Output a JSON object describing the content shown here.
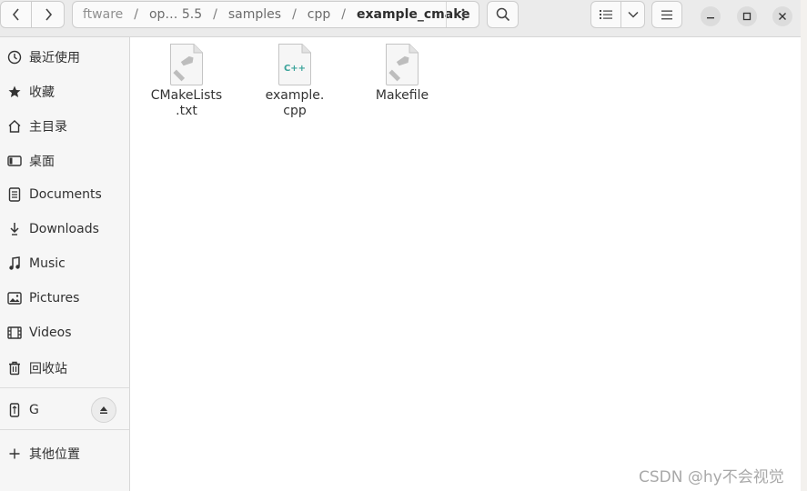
{
  "header": {
    "back_icon": "chevron-left-icon",
    "forward_icon": "chevron-right-icon",
    "path": {
      "segments": [
        "ftware",
        "op… 5.5",
        "samples",
        "cpp"
      ],
      "separator": "/",
      "current": "example_cmake"
    },
    "path_menu_icon": "vertical-ellipsis-icon",
    "search_icon": "search-icon",
    "view_icon": "list-view-icon",
    "view_dropdown_icon": "chevron-down-icon",
    "menu_icon": "hamburger-menu-icon",
    "minimize_icon": "minimize-icon",
    "maximize_icon": "maximize-icon",
    "close_icon": "close-icon"
  },
  "sidebar": {
    "items": [
      {
        "label": "最近使用",
        "icon": "clock-icon"
      },
      {
        "label": "收藏",
        "icon": "star-icon"
      },
      {
        "label": "主目录",
        "icon": "home-icon"
      },
      {
        "label": "桌面",
        "icon": "desktop-icon"
      },
      {
        "label": "Documents",
        "icon": "document-icon"
      },
      {
        "label": "Downloads",
        "icon": "download-icon"
      },
      {
        "label": "Music",
        "icon": "music-icon"
      },
      {
        "label": "Pictures",
        "icon": "picture-icon"
      },
      {
        "label": "Videos",
        "icon": "video-icon"
      },
      {
        "label": "回收站",
        "icon": "trash-icon"
      }
    ],
    "drive": {
      "label": "G",
      "icon": "usb-drive-icon",
      "eject_icon": "eject-icon"
    },
    "other": {
      "label": "其他位置",
      "icon": "plus-icon"
    }
  },
  "files": [
    {
      "name": "CMakeLists\n.txt",
      "icon": "build-file-icon"
    },
    {
      "name": "example.\ncpp",
      "icon": "cpp-file-icon",
      "badge": "C++"
    },
    {
      "name": "Makefile",
      "icon": "build-file-icon"
    }
  ],
  "watermark": "CSDN @hy不会视觉",
  "colors": {
    "cpp_badge": "#3aa39a",
    "hammer": "#bdbdbd"
  }
}
